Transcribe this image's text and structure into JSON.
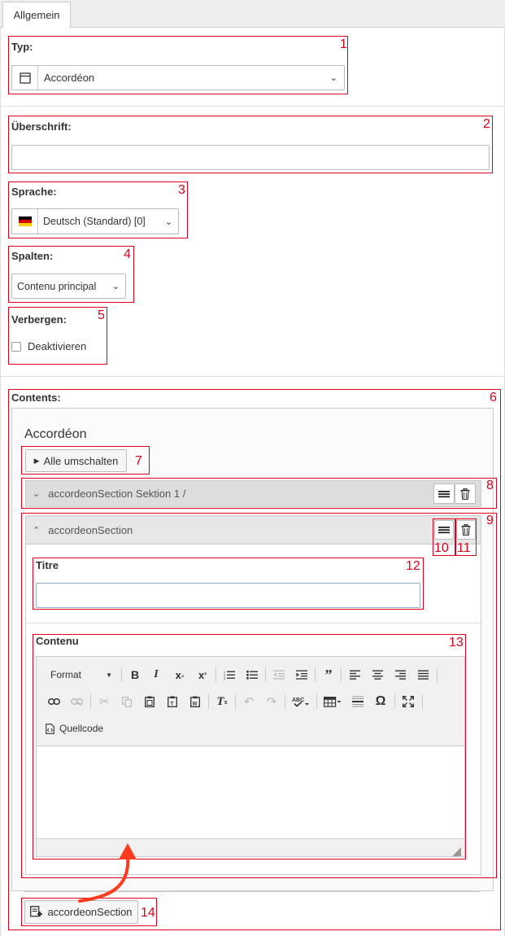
{
  "tabs": [
    {
      "label": "Allgemein"
    }
  ],
  "typ": {
    "label": "Typ:",
    "value": "Accordéon",
    "num": "1"
  },
  "ueberschrift": {
    "label": "Überschrift:",
    "value": "",
    "num": "2"
  },
  "sprache": {
    "label": "Sprache:",
    "value": "Deutsch (Standard) [0]",
    "num": "3"
  },
  "spalten": {
    "label": "Spalten:",
    "value": "Contenu principal",
    "num": "4"
  },
  "verbergen": {
    "label": "Verbergen:",
    "checkbox_label": "Deaktivieren",
    "checked": false,
    "num": "5"
  },
  "contents": {
    "label": "Contents:",
    "num": "6",
    "title": "Accordéon",
    "toggle_all": "Alle umschalten",
    "toggle_num": "7",
    "section1": {
      "label": "accordeonSection Sektion 1 /",
      "num": "8"
    },
    "section2": {
      "label": "accordeonSection",
      "num": "9",
      "drag_num": "10",
      "delete_num": "11",
      "titre": {
        "label": "Titre",
        "value": "",
        "num": "12"
      },
      "contenu": {
        "label": "Contenu",
        "num": "13",
        "format": "Format",
        "source": "Quellcode"
      }
    },
    "add_button": "accordeonSection",
    "add_num": "14"
  },
  "colors": {
    "annotation": "#e0001a",
    "arrow": "#ff3b1f"
  }
}
